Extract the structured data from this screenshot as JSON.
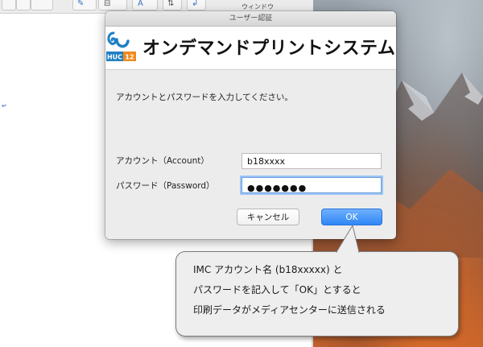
{
  "background": {
    "toolbar": {
      "menu_label": "ウィンドウ"
    }
  },
  "dialog": {
    "title": "ユーザー認証",
    "banner": {
      "logo_text": "HUC",
      "logo_number": "12",
      "title": "オンデマンドプリントシステム"
    },
    "prompt": "アカウントとパスワードを入力してください。",
    "account": {
      "label": "アカウント（Account）",
      "value": "b18xxxx"
    },
    "password": {
      "label": "パスワード（Password）",
      "masked_value": "●●●●●●●"
    },
    "buttons": {
      "cancel": "キャンセル",
      "ok": "OK"
    }
  },
  "callout": {
    "lines": [
      "IMC アカウント名 (b18xxxxx) と",
      "パスワードを記入して「OK」とすると",
      "印刷データがメディアセンターに送信される"
    ]
  },
  "colors": {
    "accent_blue": "#2f86f5",
    "logo_orange": "#f08a1c",
    "logo_blue": "#1f7fc4"
  }
}
